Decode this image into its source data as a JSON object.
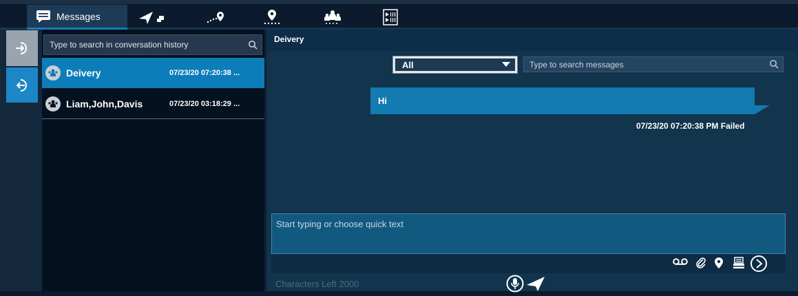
{
  "tabs": [
    {
      "label": "Messages",
      "icon": "messages-icon"
    },
    {
      "icon": "navigate-icon"
    },
    {
      "icon": "route-icon"
    },
    {
      "icon": "location-pin-icon"
    },
    {
      "icon": "group-icon"
    },
    {
      "icon": "media-icon"
    }
  ],
  "conversation_search": {
    "placeholder": "Type to search in conversation history"
  },
  "conversations": [
    {
      "name": "Deivery",
      "time": "07/23/20 07:20:38 ...",
      "selected": true
    },
    {
      "name": "Liam,John,Davis",
      "time": "07/23/20 03:18:29 ...",
      "selected": false
    }
  ],
  "chat": {
    "title": "Deivery",
    "filter_value": "All",
    "message_search_placeholder": "Type to search messages",
    "messages": [
      {
        "text": "Hi",
        "meta": "07/23/20 07:20:38 PM Failed"
      }
    ],
    "compose_placeholder": "Start typing or choose quick text",
    "characters_left": "Characters Left 2000"
  },
  "colors": {
    "accent": "#127bb1",
    "background": "#0b1a2c",
    "chat_bg": "#12344d"
  }
}
